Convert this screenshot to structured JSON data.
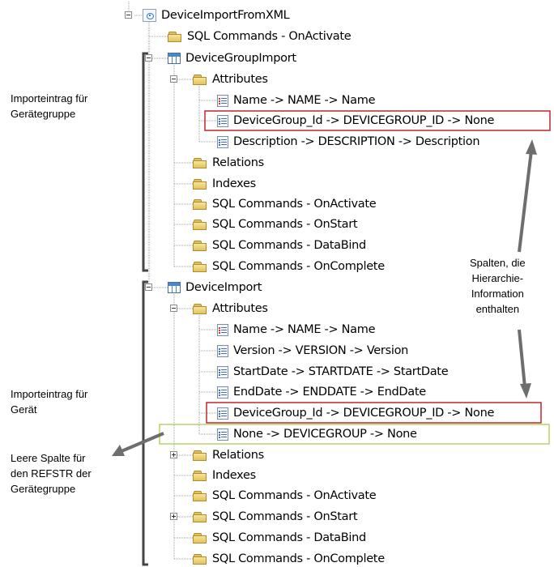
{
  "tree": {
    "root": "DeviceImportFromXML",
    "nodes": [
      {
        "label": "SQL Commands - OnActivate",
        "icon": "folder"
      },
      {
        "label": "DeviceGroupImport",
        "icon": "table"
      },
      {
        "label": "Attributes",
        "icon": "folder"
      },
      {
        "label": "Name -> NAME -> Name",
        "icon": "attribute-key"
      },
      {
        "label": "DeviceGroup_Id -> DEVICEGROUP_ID -> None",
        "icon": "attribute"
      },
      {
        "label": "Description -> DESCRIPTION -> Description",
        "icon": "attribute"
      },
      {
        "label": "Relations",
        "icon": "folder"
      },
      {
        "label": "Indexes",
        "icon": "folder"
      },
      {
        "label": "SQL Commands - OnActivate",
        "icon": "folder"
      },
      {
        "label": "SQL Commands - OnStart",
        "icon": "folder"
      },
      {
        "label": "SQL Commands - DataBind",
        "icon": "folder"
      },
      {
        "label": "SQL Commands - OnComplete",
        "icon": "folder"
      },
      {
        "label": "DeviceImport",
        "icon": "table"
      },
      {
        "label": "Attributes",
        "icon": "folder"
      },
      {
        "label": "Name -> NAME -> Name",
        "icon": "attribute-key"
      },
      {
        "label": "Version -> VERSION -> Version",
        "icon": "attribute"
      },
      {
        "label": "StartDate -> STARTDATE -> StartDate",
        "icon": "attribute"
      },
      {
        "label": "EndDate -> ENDDATE -> EndDate",
        "icon": "attribute"
      },
      {
        "label": "DeviceGroup_Id -> DEVICEGROUP_ID -> None",
        "icon": "attribute"
      },
      {
        "label": "None -> DEVICEGROUP -> None",
        "icon": "attribute"
      },
      {
        "label": "Relations",
        "icon": "folder"
      },
      {
        "label": "Indexes",
        "icon": "folder"
      },
      {
        "label": "SQL Commands - OnActivate",
        "icon": "folder"
      },
      {
        "label": "SQL Commands - OnStart",
        "icon": "folder"
      },
      {
        "label": "SQL Commands - DataBind",
        "icon": "folder"
      },
      {
        "label": "SQL Commands - OnComplete",
        "icon": "folder"
      }
    ]
  },
  "annotations": {
    "group_entry": "Importeintrag für\nGerätegruppe",
    "hierarchy_columns": "Spalten, die\nHierarchie-\nInformation\nenthalten",
    "device_entry": "Importeintrag für\nGerät",
    "empty_column": "Leere Spalte für\nden REFSTR der\nGerätegruppe"
  },
  "colors": {
    "highlight_red": "#c0262c",
    "highlight_green": "#b6d36a",
    "bracket": "#444444",
    "arrow": "#6e6e6e"
  }
}
